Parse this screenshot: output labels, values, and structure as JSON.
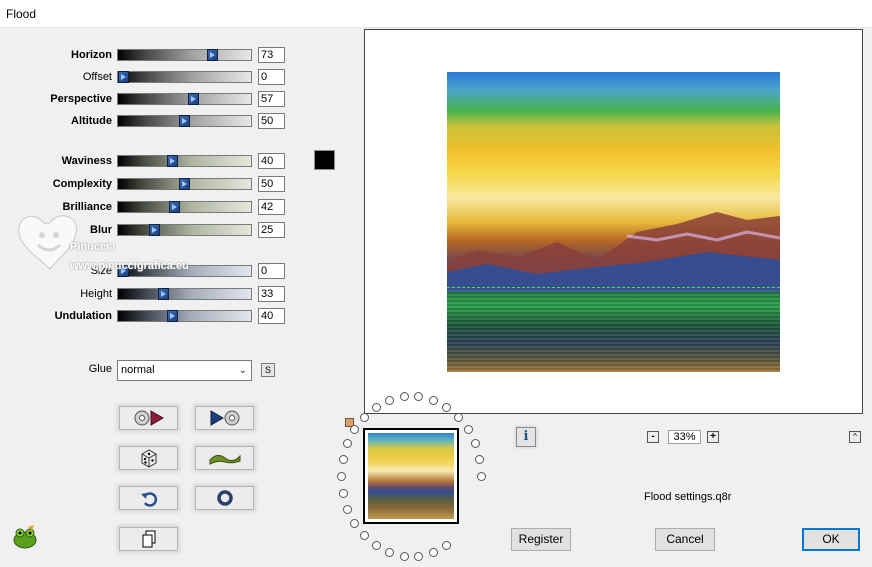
{
  "window": {
    "title": "Flood"
  },
  "sliders": [
    {
      "label": "Horizon",
      "bold_initial": "H",
      "value": "73",
      "fraction": 0.73,
      "style": "gray"
    },
    {
      "label": "Offset",
      "bold_initial": "",
      "value": "0",
      "fraction": 0.0,
      "style": "gray"
    },
    {
      "label": "Perspective",
      "bold_initial": "P",
      "value": "57",
      "fraction": 0.57,
      "style": "gray"
    },
    {
      "label": "Altitude",
      "bold_initial": "A",
      "value": "50",
      "fraction": 0.5,
      "style": "gray"
    },
    {
      "label": "Waviness",
      "bold_initial": "W",
      "value": "40",
      "fraction": 0.4,
      "style": "green"
    },
    {
      "label": "Complexity",
      "bold_initial": "C",
      "value": "50",
      "fraction": 0.5,
      "style": "green"
    },
    {
      "label": "Brilliance",
      "bold_initial": "B",
      "value": "42",
      "fraction": 0.42,
      "style": "green"
    },
    {
      "label": "Blur",
      "bold_initial": "B",
      "value": "25",
      "fraction": 0.25,
      "style": "green"
    },
    {
      "label": "Size",
      "bold_initial": "",
      "value": "0",
      "fraction": 0.0,
      "style": "blue"
    },
    {
      "label": "Height",
      "bold_initial": "",
      "value": "33",
      "fraction": 0.33,
      "style": "blue"
    },
    {
      "label": "Undulation",
      "bold_initial": "U",
      "value": "40",
      "fraction": 0.4,
      "style": "blue"
    }
  ],
  "color_swatch": {
    "color": "#000000"
  },
  "glue": {
    "label": "Glue",
    "selected": "normal",
    "s_button": "S"
  },
  "tool_buttons": [
    {
      "name": "load-preset",
      "icon": "disc-arrow-icon"
    },
    {
      "name": "save-preset",
      "icon": "arrow-disc-icon"
    },
    {
      "name": "randomize",
      "icon": "dice-icon"
    },
    {
      "name": "wave-preview",
      "icon": "wave-icon"
    },
    {
      "name": "undo",
      "icon": "undo-icon"
    },
    {
      "name": "reset",
      "icon": "ring-icon"
    },
    {
      "name": "copy",
      "icon": "copy-icon"
    }
  ],
  "watermark": {
    "name": "Pinuccia",
    "site": "www.pinuccigrafica.eu"
  },
  "zoom": {
    "value": "33%",
    "minus": "-",
    "plus": "+"
  },
  "info_button": "i",
  "collapse_button": "^",
  "settings_file": "Flood settings.q8r",
  "buttons": {
    "register": "Register",
    "cancel": "Cancel",
    "ok": "OK"
  },
  "colors": {
    "accent": "#0078d7",
    "horizon_line": "#39e34a"
  }
}
